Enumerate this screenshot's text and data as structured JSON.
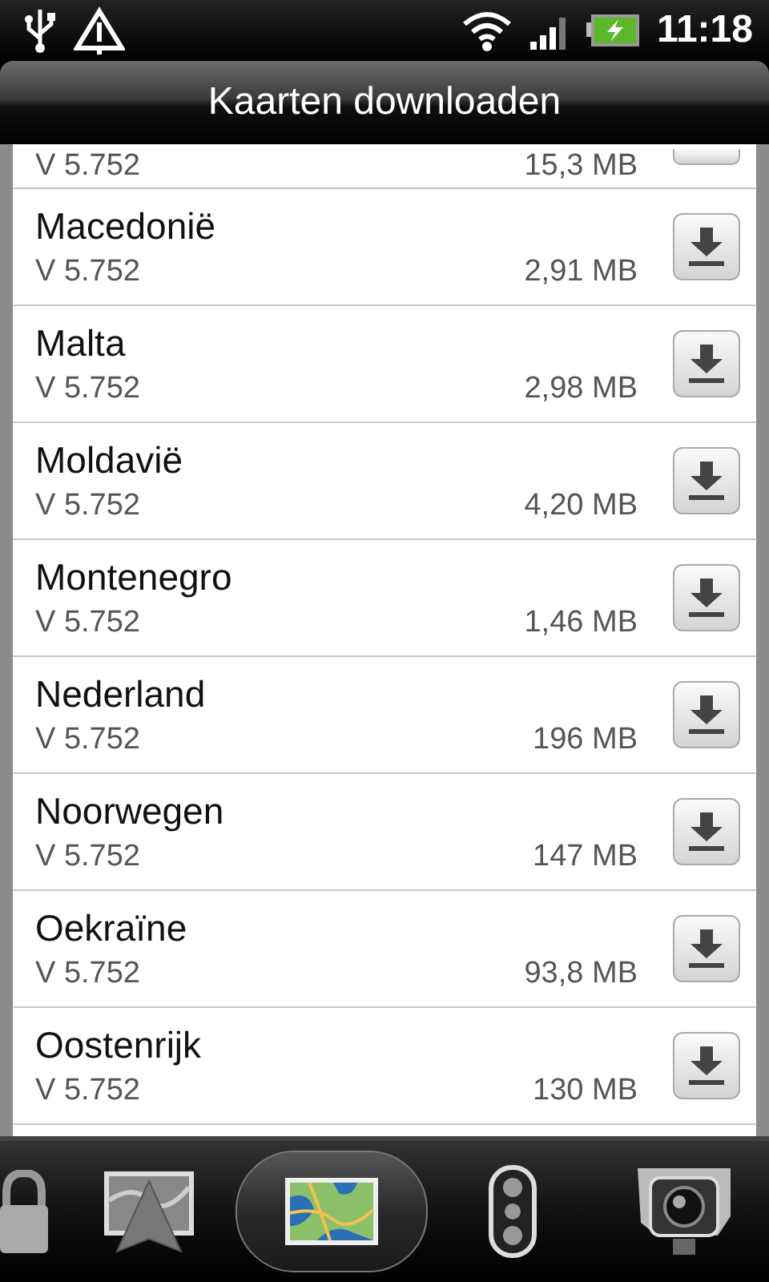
{
  "status_bar": {
    "time": "11:18"
  },
  "title": "Kaarten downloaden",
  "partial_row": {
    "version": "V 5.752",
    "size": "15,3 MB"
  },
  "maps": [
    {
      "name": "Macedonië",
      "version": "V 5.752",
      "size": "2,91 MB"
    },
    {
      "name": "Malta",
      "version": "V 5.752",
      "size": "2,98 MB"
    },
    {
      "name": "Moldavië",
      "version": "V 5.752",
      "size": "4,20 MB"
    },
    {
      "name": "Montenegro",
      "version": "V 5.752",
      "size": "1,46 MB"
    },
    {
      "name": "Nederland",
      "version": "V 5.752",
      "size": "196 MB"
    },
    {
      "name": "Noorwegen",
      "version": "V 5.752",
      "size": "147 MB"
    },
    {
      "name": "Oekraïne",
      "version": "V 5.752",
      "size": "93,8 MB"
    },
    {
      "name": "Oostenrijk",
      "version": "V 5.752",
      "size": "130 MB"
    }
  ],
  "dock": [
    {
      "kind": "lock",
      "selected": false
    },
    {
      "kind": "navigation",
      "selected": false
    },
    {
      "kind": "map",
      "selected": true
    },
    {
      "kind": "lights",
      "selected": false
    },
    {
      "kind": "camera",
      "selected": false
    }
  ]
}
